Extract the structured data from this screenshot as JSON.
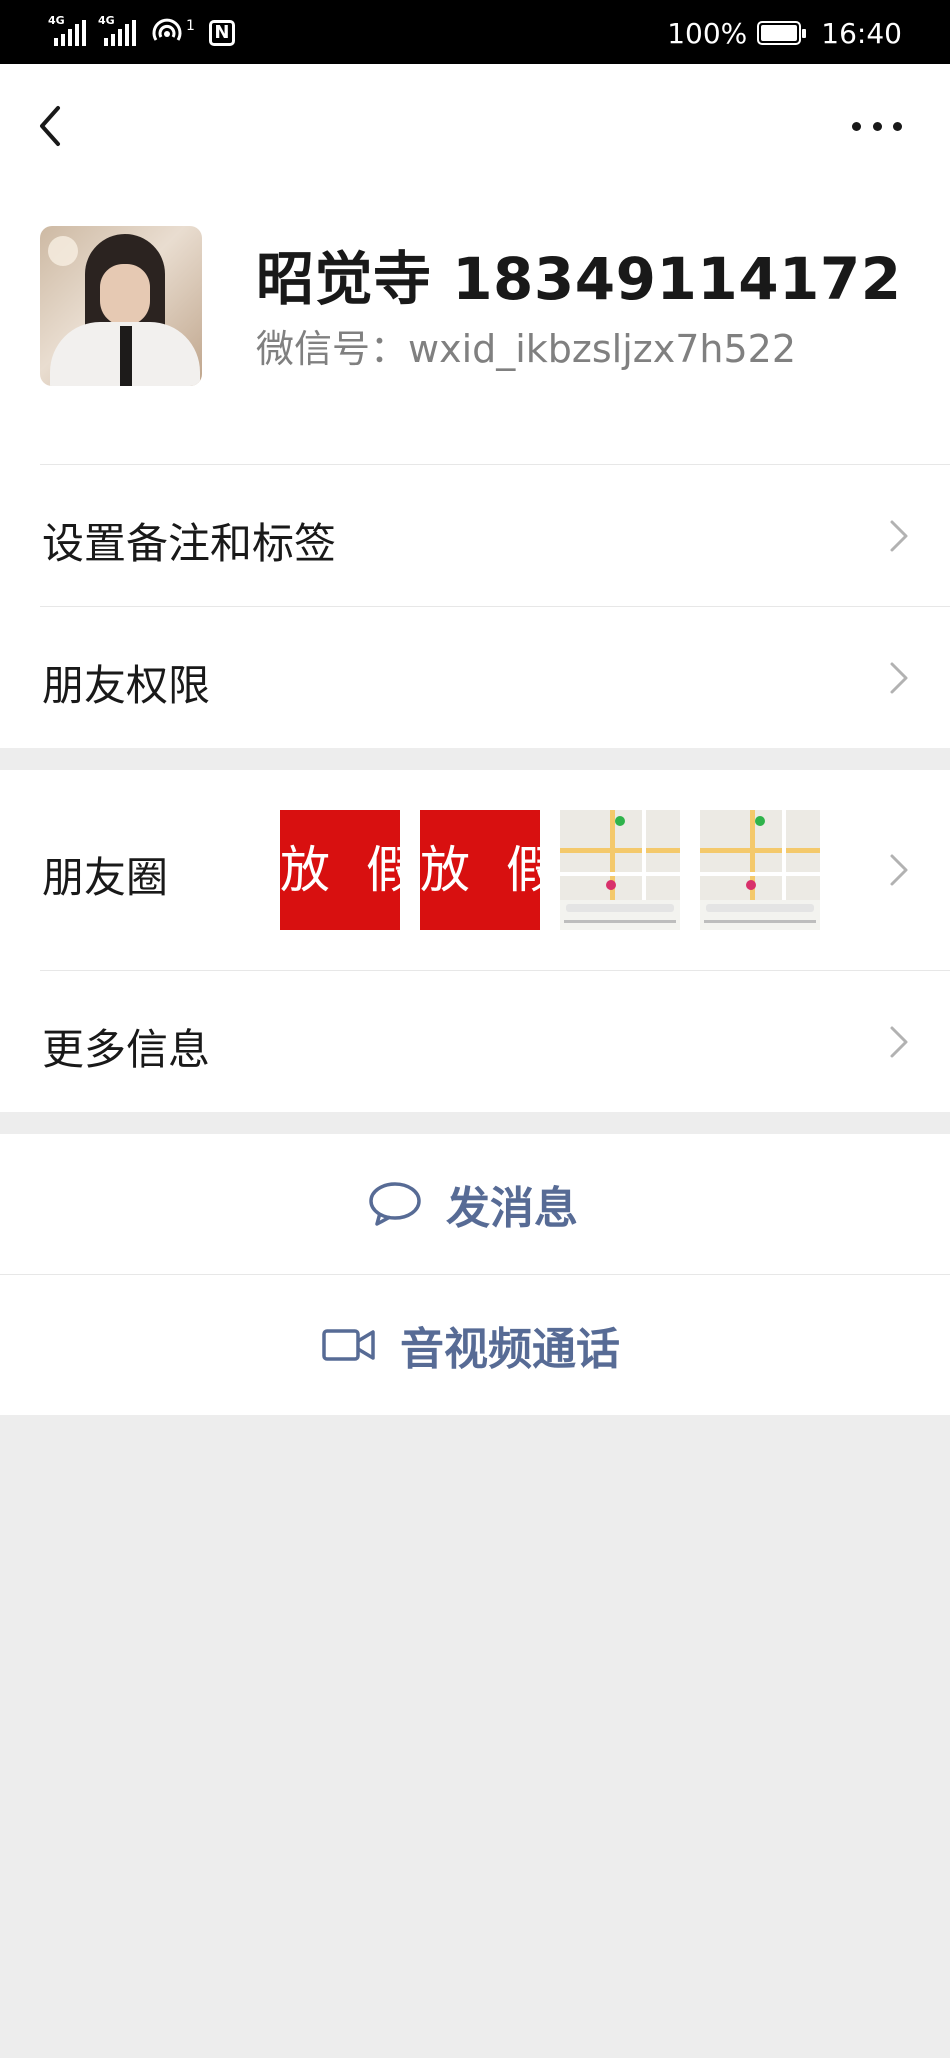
{
  "status_bar": {
    "left_signal_1": "4G",
    "left_signal_2": "4G",
    "hotspot_count": "1",
    "nfc": "N",
    "battery": "100%",
    "time": "16:40"
  },
  "nav": {
    "back_icon": "chevron-left-icon",
    "more_icon": "more-dots-icon"
  },
  "profile": {
    "name": "昭觉寺 18349114172",
    "wechat_id": "微信号：wxid_ikbzsljzx7h522"
  },
  "menu": {
    "remark_tags": "设置备注和标签",
    "friend_permissions": "朋友权限",
    "moments": "朋友圈",
    "more_info": "更多信息"
  },
  "moments_thumbs": [
    {
      "type": "text-image",
      "text": "放 假"
    },
    {
      "type": "text-image",
      "text": "放 假"
    },
    {
      "type": "map-screenshot"
    },
    {
      "type": "map-screenshot"
    }
  ],
  "actions": {
    "send_message": "发消息",
    "video_call": "音视频通话"
  },
  "colors": {
    "link_blue": "#576b95",
    "page_bg": "#ededed",
    "thumb_red": "#d81010"
  }
}
